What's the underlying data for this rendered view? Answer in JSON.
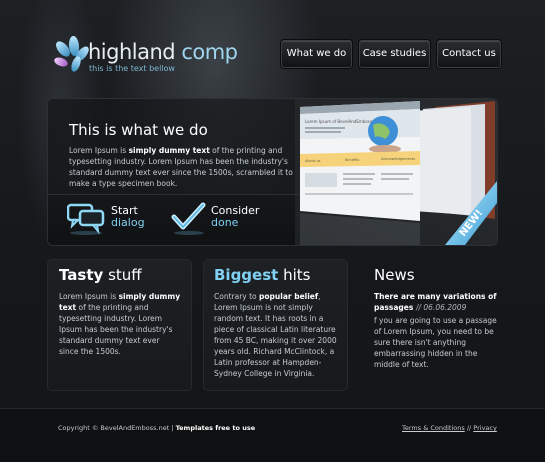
{
  "header": {
    "logo_icon": "petal-logo-icon",
    "title_main": "highland ",
    "title_light": "comp",
    "subtitle": "this is the text bellow",
    "accent": "#7fd0f2"
  },
  "nav": {
    "items": [
      {
        "label": "What we do"
      },
      {
        "label": "Case studies"
      },
      {
        "label": "Contact us"
      }
    ]
  },
  "hero": {
    "title": "This is what we do",
    "text_before": "Lorem Ipsum is ",
    "text_bold": "simply dummy text",
    "text_after": " of the printing and typesetting industry. Lorem Ipsum has been the industry's standard dummy text ever since the 1500s, scrambled it to make a type specimen book.",
    "actions": [
      {
        "icon": "speech-bubbles-icon",
        "line1": "Start",
        "line2": "dialog"
      },
      {
        "icon": "checkmark-icon",
        "line1": "Consider",
        "line2": "done"
      }
    ],
    "badge": "NEW!",
    "screenshot": {
      "site_text": "Lorem Ipsum of BevelAndEmboss",
      "tabs": [
        "About us",
        "Benefits",
        "Acknowledgements"
      ]
    }
  },
  "columns": [
    {
      "title_strong": "Tasty",
      "title_rest": " stuff",
      "text_before": "Lorem Ipsum is ",
      "text_bold": "simply dummy text",
      "text_after": " of the printing and typesetting industry. Lorem Ipsum has been the industry's standard dummy text ever since the 1500s."
    },
    {
      "title_strong": "Biggest",
      "title_rest": " hits",
      "text_before": "Contrary to ",
      "text_bold": "popular belief",
      "text_after": ", Lorem Ipsum is not simply random text. It has roots in a piece of classical Latin literature from 45 BC, making it over 2000 years old. Richard McClintock, a Latin professor at Hampden-Sydney College in Virginia."
    }
  ],
  "news": {
    "title": "News",
    "headline": "There are many variations of passages",
    "date": "// 06.06.2009",
    "body": "f you are going to use a passage of Lorem Ipsum, you need to be sure there isn't anything embarrassing hidden in the middle of text."
  },
  "footer": {
    "copyright": "Copyright © BevelAndEmboss.net",
    "separator": " | ",
    "tagline": "Templates free to use",
    "links": [
      {
        "label": "Terms & Conditions"
      },
      {
        "label": "Privacy"
      }
    ],
    "link_sep": "//"
  }
}
